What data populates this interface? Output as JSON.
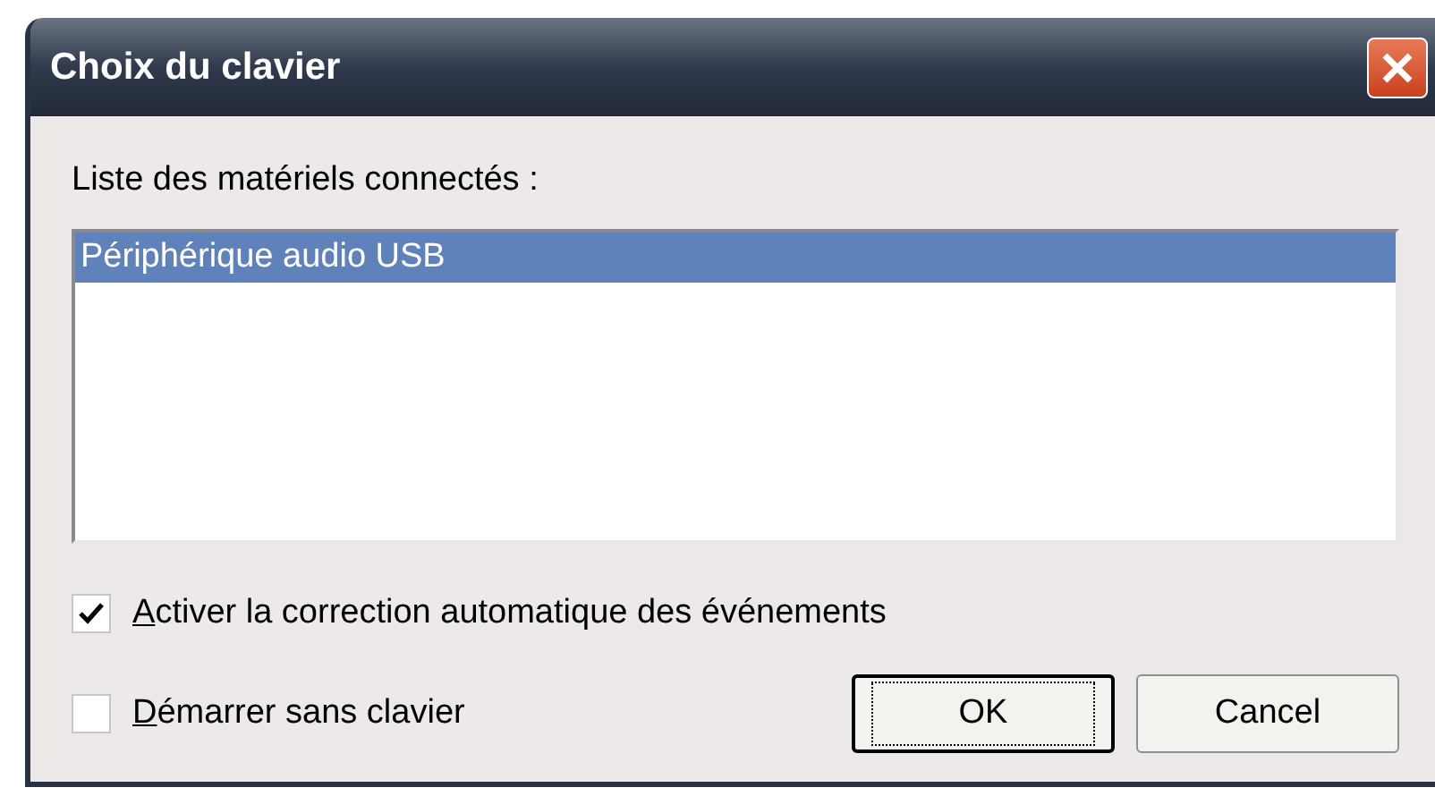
{
  "window": {
    "title": "Choix du clavier"
  },
  "list_label": "Liste des matériels connectés :",
  "devices": [
    {
      "label": "Périphérique audio USB",
      "selected": true
    }
  ],
  "options": [
    {
      "label": "Activer la correction automatique des événements",
      "checked": true
    },
    {
      "label": "Démarrer sans clavier",
      "checked": false
    }
  ],
  "buttons": [
    {
      "label": "OK",
      "default": true
    },
    {
      "label": "Cancel",
      "default": false
    }
  ]
}
